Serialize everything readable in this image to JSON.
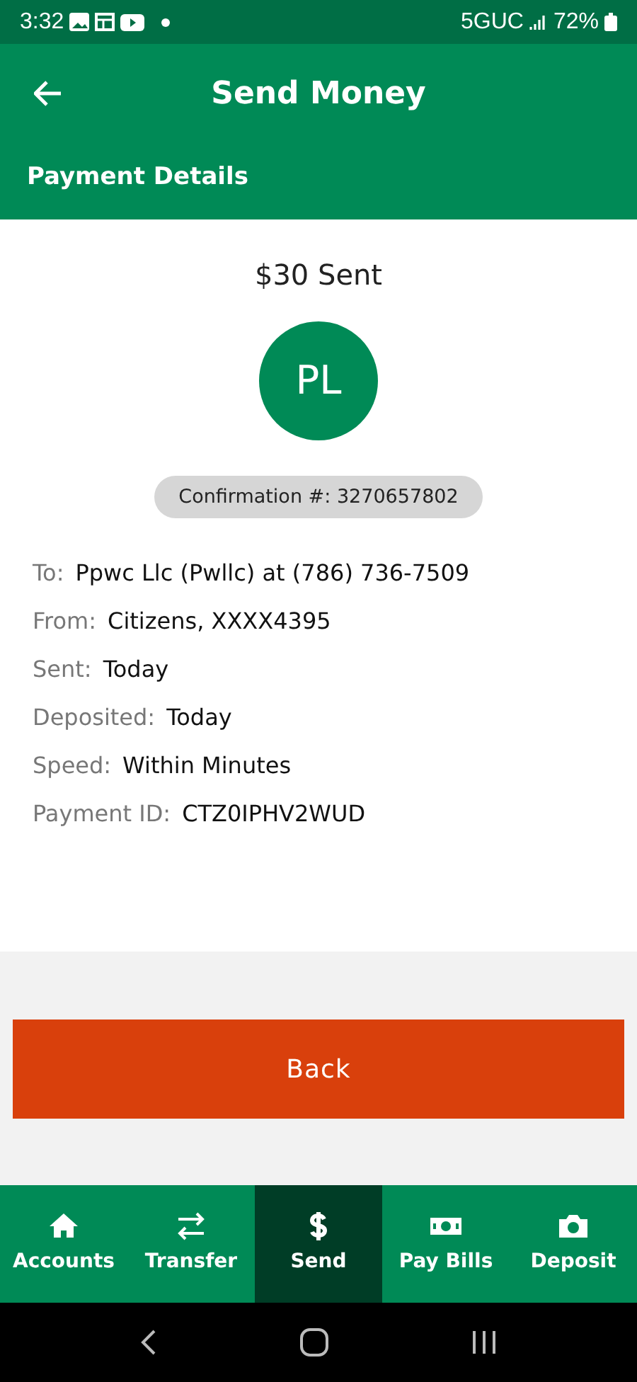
{
  "status_bar": {
    "time": "3:32",
    "network": "5GUC",
    "battery": "72%"
  },
  "header": {
    "title": "Send Money",
    "subtitle": "Payment Details"
  },
  "summary": {
    "amount": "$30 Sent",
    "initials": "PL",
    "confirmation": "Confirmation #: 3270657802"
  },
  "details": [
    {
      "label": "To:",
      "value": "Ppwc Llc (Pwllc) at (786) 736-7509"
    },
    {
      "label": "From:",
      "value": "Citizens, XXXX4395"
    },
    {
      "label": "Sent:",
      "value": "Today"
    },
    {
      "label": "Deposited:",
      "value": "Today"
    },
    {
      "label": "Speed:",
      "value": "Within Minutes"
    },
    {
      "label": "Payment ID:",
      "value": "CTZ0IPHV2WUD"
    }
  ],
  "back_button": "Back",
  "tabs": [
    {
      "label": "Accounts",
      "kind": "home",
      "selected": false
    },
    {
      "label": "Transfer",
      "kind": "transfer",
      "selected": false
    },
    {
      "label": "Send",
      "kind": "dollar",
      "selected": true
    },
    {
      "label": "Pay Bills",
      "kind": "bill",
      "selected": false
    },
    {
      "label": "Deposit",
      "kind": "camera",
      "selected": false
    }
  ]
}
